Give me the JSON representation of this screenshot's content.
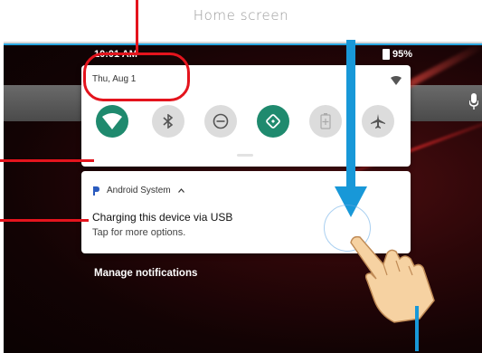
{
  "caption": "Home screen",
  "statusbar": {
    "time": "10:01 AM",
    "battery": "95%"
  },
  "quick_settings": {
    "date": "Thu, Aug 1",
    "tiles": [
      {
        "name": "wifi-tile",
        "icon": "wifi-icon",
        "state": "on"
      },
      {
        "name": "bluetooth-tile",
        "icon": "bluetooth-icon",
        "state": "off"
      },
      {
        "name": "do-not-disturb-tile",
        "icon": "do-not-disturb-icon",
        "state": "off"
      },
      {
        "name": "auto-rotate-tile",
        "icon": "auto-rotate-icon",
        "state": "on"
      },
      {
        "name": "battery-saver-tile",
        "icon": "battery-saver-icon",
        "state": "off"
      },
      {
        "name": "airplane-mode-tile",
        "icon": "airplane-icon",
        "state": "off"
      }
    ]
  },
  "notification": {
    "app": "Android System",
    "title": "Charging this device via USB",
    "subtitle": "Tap for more options."
  },
  "manage_label": "Manage notifications",
  "colors": {
    "callout": "#e4141d",
    "arrow": "#1898d8",
    "tile_on": "#1f8a6e",
    "tile_off": "#dcdcdc"
  }
}
